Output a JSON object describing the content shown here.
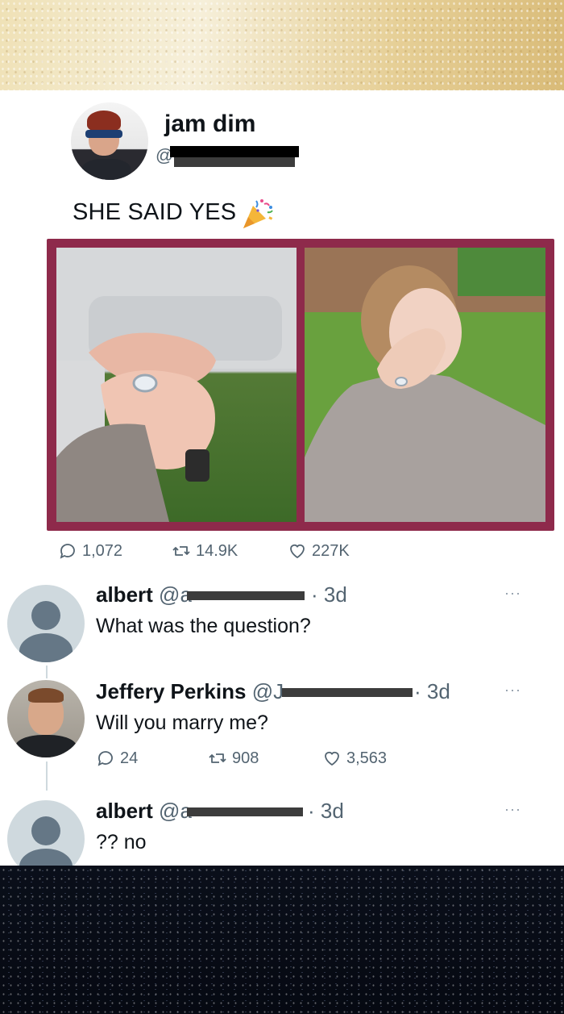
{
  "tweet": {
    "display_name": "jam dim",
    "handle": "@",
    "text": "SHE SAID YES",
    "text_emoji_icon": "party-popper-icon",
    "media": [
      {
        "name": "photo-ring-hand"
      },
      {
        "name": "photo-woman-showing-ring"
      }
    ],
    "stats": {
      "replies": "1,072",
      "retweets": "14.9K",
      "likes": "227K"
    },
    "colors": {
      "frame": "#8e2a4b",
      "secondary_text": "#536471"
    }
  },
  "replies": [
    {
      "name": "albert",
      "handle": "@a",
      "time": "· 3d",
      "text": "What was the question?",
      "more": "···"
    },
    {
      "name": "Jeffery Perkins",
      "handle": "@J",
      "time": "· 3d",
      "text": "Will you marry me?",
      "more": "···",
      "stats": {
        "replies": "24",
        "retweets": "908",
        "likes": "3,563"
      }
    },
    {
      "name": "albert",
      "handle": "@a",
      "time": "· 3d",
      "text": "?? no",
      "more": "···"
    }
  ]
}
